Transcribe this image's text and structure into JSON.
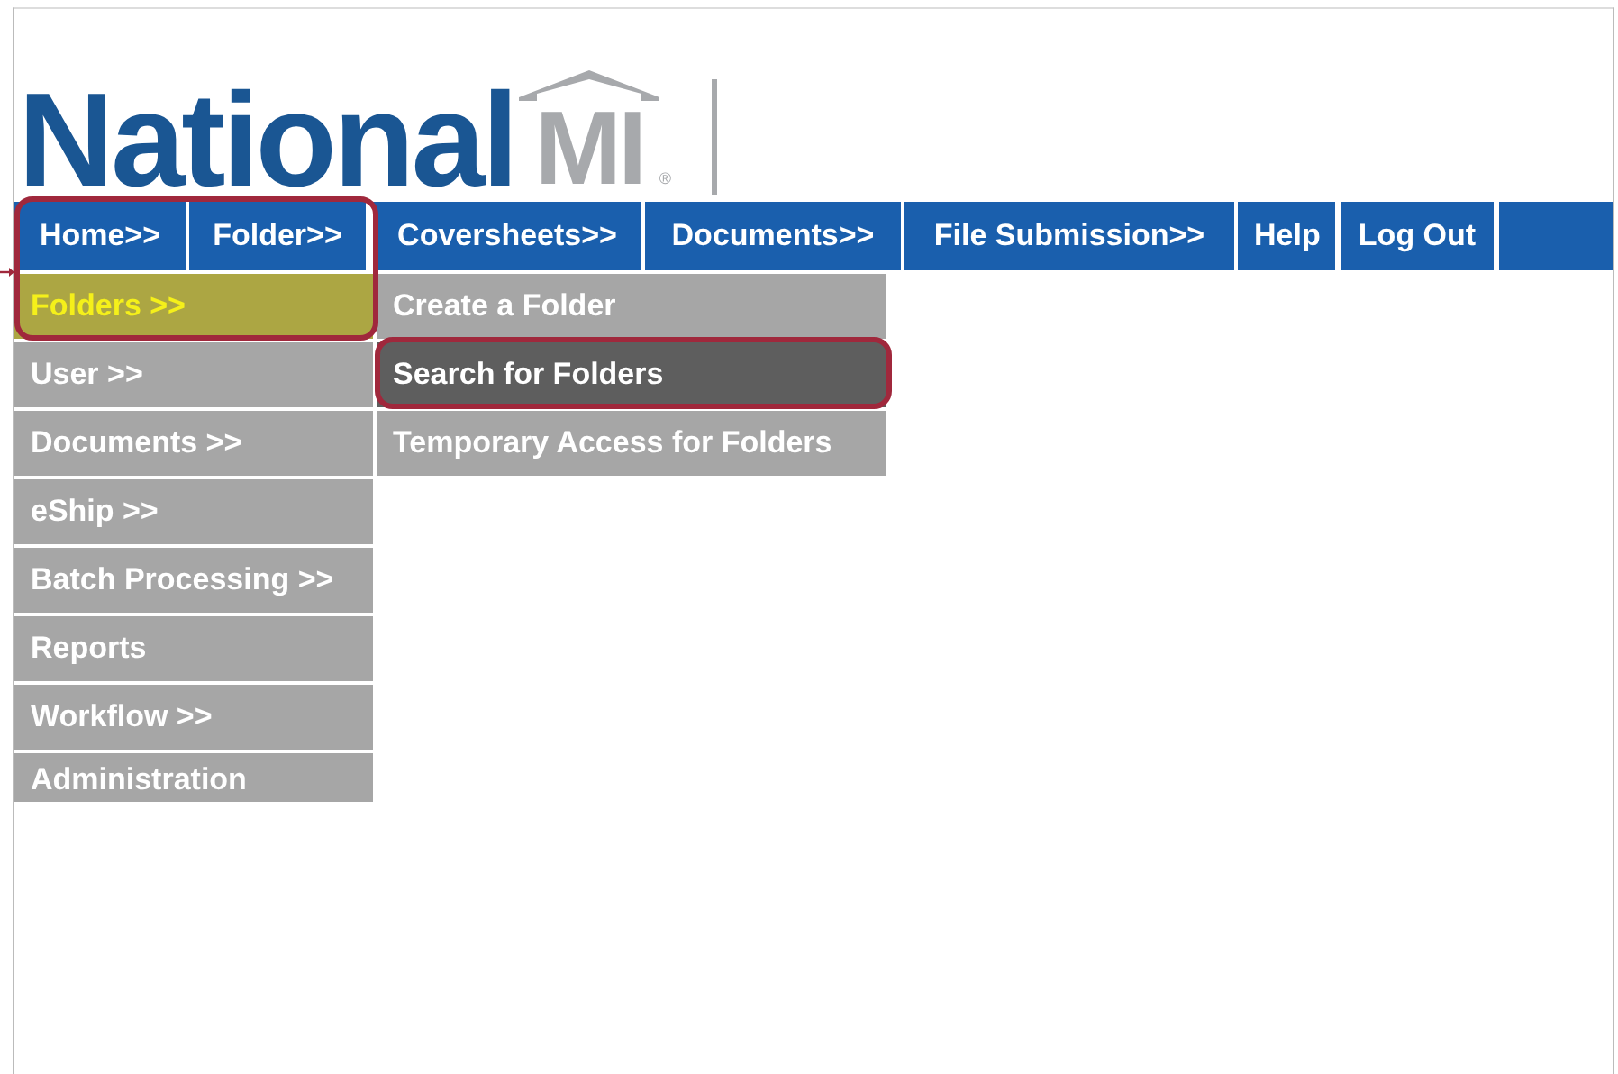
{
  "logo": {
    "name": "National",
    "mark": "MI",
    "registered": "®"
  },
  "nav": [
    {
      "label": "Home>>"
    },
    {
      "label": "Folder>>"
    },
    {
      "label": "Coversheets>>"
    },
    {
      "label": "Documents>>"
    },
    {
      "label": "File Submission>>"
    },
    {
      "label": "Help"
    },
    {
      "label": "Log Out"
    }
  ],
  "menu": [
    {
      "label": "Folders >>",
      "selected": true,
      "circled": true
    },
    {
      "label": "User >>",
      "selected": false,
      "circled": false
    },
    {
      "label": "Documents >>",
      "selected": false,
      "circled": false
    },
    {
      "label": "eShip >>",
      "selected": false,
      "circled": false
    },
    {
      "label": "Batch Processing >>",
      "selected": false,
      "circled": false
    },
    {
      "label": "Reports",
      "selected": false,
      "circled": false
    },
    {
      "label": "Workflow >>",
      "selected": false,
      "circled": false
    },
    {
      "label": "Administration",
      "selected": false,
      "circled": false
    }
  ],
  "submenu": [
    {
      "label": "Create a Folder",
      "selected": false,
      "circled": false
    },
    {
      "label": "Search for Folders",
      "selected": true,
      "circled": true
    },
    {
      "label": "Temporary Access for Folders",
      "selected": false,
      "circled": false
    }
  ]
}
